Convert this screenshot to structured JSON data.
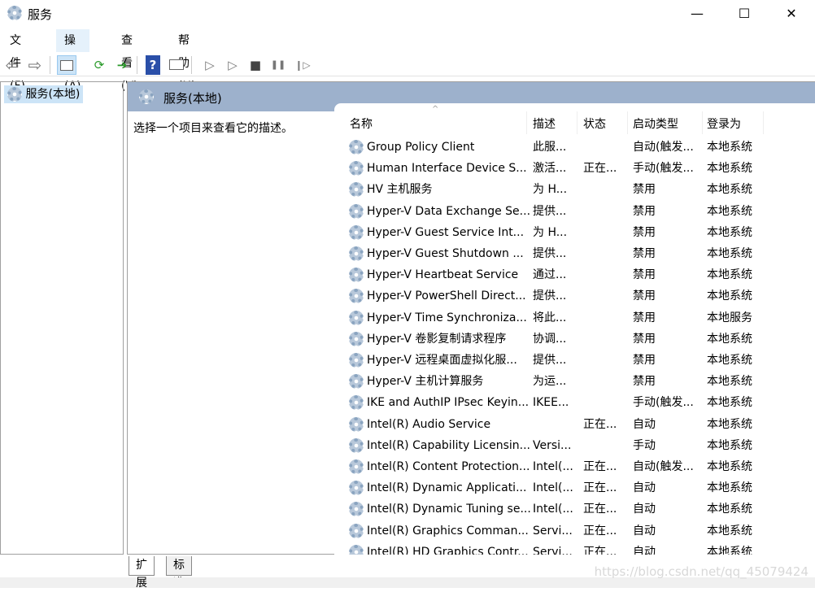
{
  "window": {
    "title": "服务",
    "minimize": "—",
    "maximize": "☐",
    "close": "✕"
  },
  "menu": [
    "文件(F)",
    "操作(A)",
    "查看(V)",
    "帮助(H)"
  ],
  "toolbar": {
    "back": "⇦",
    "forward": "⇨",
    "help": "?",
    "play": "▷",
    "play2": "▷",
    "stop": "■",
    "pause": "❚❚",
    "resume": "❙▷"
  },
  "tree": {
    "item": "服务(本地)"
  },
  "panel": {
    "title": "服务(本地)",
    "description_prompt": "选择一个项目来查看它的描述。"
  },
  "columns": [
    "名称",
    "描述",
    "状态",
    "启动类型",
    "登录为"
  ],
  "rows": [
    [
      "Group Policy Client",
      "此服...",
      "",
      "自动(触发...",
      "本地系统"
    ],
    [
      "Human Interface Device S...",
      "激活...",
      "正在...",
      "手动(触发...",
      "本地系统"
    ],
    [
      "HV 主机服务",
      "为 H...",
      "",
      "禁用",
      "本地系统"
    ],
    [
      "Hyper-V Data Exchange Se...",
      "提供...",
      "",
      "禁用",
      "本地系统"
    ],
    [
      "Hyper-V Guest Service Int...",
      "为 H...",
      "",
      "禁用",
      "本地系统"
    ],
    [
      "Hyper-V Guest Shutdown ...",
      "提供...",
      "",
      "禁用",
      "本地系统"
    ],
    [
      "Hyper-V Heartbeat Service",
      "通过...",
      "",
      "禁用",
      "本地系统"
    ],
    [
      "Hyper-V PowerShell Direct...",
      "提供...",
      "",
      "禁用",
      "本地系统"
    ],
    [
      "Hyper-V Time Synchroniza...",
      "将此...",
      "",
      "禁用",
      "本地服务"
    ],
    [
      "Hyper-V 卷影复制请求程序",
      "协调...",
      "",
      "禁用",
      "本地系统"
    ],
    [
      "Hyper-V 远程桌面虚拟化服...",
      "提供...",
      "",
      "禁用",
      "本地系统"
    ],
    [
      "Hyper-V 主机计算服务",
      "为运...",
      "",
      "禁用",
      "本地系统"
    ],
    [
      "IKE and AuthIP IPsec Keyin...",
      "IKEE...",
      "",
      "手动(触发...",
      "本地系统"
    ],
    [
      "Intel(R) Audio Service",
      "",
      "正在...",
      "自动",
      "本地系统"
    ],
    [
      "Intel(R) Capability Licensin...",
      "Versi...",
      "",
      "手动",
      "本地系统"
    ],
    [
      "Intel(R) Content Protection...",
      "Intel(...",
      "正在...",
      "自动(触发...",
      "本地系统"
    ],
    [
      "Intel(R) Dynamic Applicati...",
      "Intel(...",
      "正在...",
      "自动",
      "本地系统"
    ],
    [
      "Intel(R) Dynamic Tuning se...",
      "Intel(...",
      "正在...",
      "自动",
      "本地系统"
    ],
    [
      "Intel(R) Graphics Comman...",
      "Servi...",
      "正在...",
      "自动",
      "本地系统"
    ],
    [
      "Intel(R) HD Graphics Contr...",
      "Servi...",
      "正在...",
      "自动",
      "本地系统"
    ]
  ],
  "tabs": [
    "扩展",
    "标准"
  ],
  "watermark": "https://blog.csdn.net/qq_45079424"
}
